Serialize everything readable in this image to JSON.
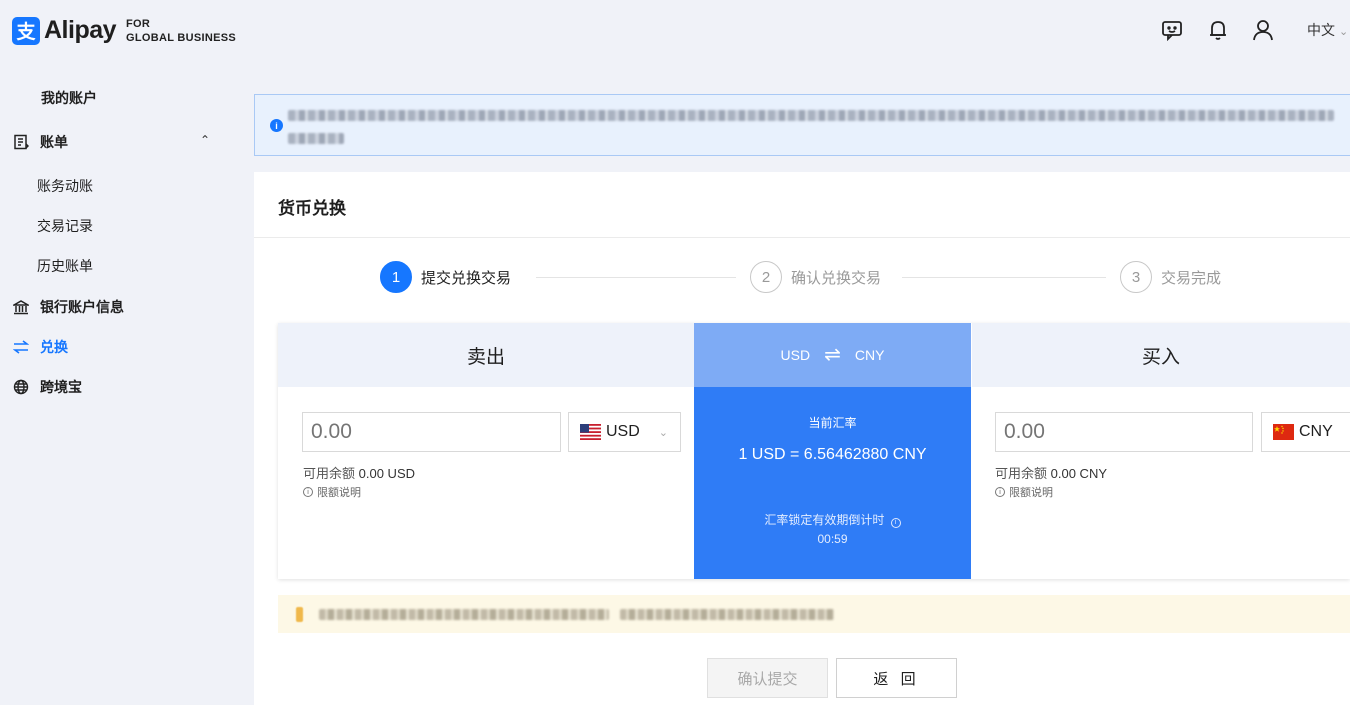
{
  "header": {
    "logo_text": "Alipay",
    "logo_sub_line1": "FOR",
    "logo_sub_line2": "GLOBAL BUSINESS",
    "language": "中文",
    "icons": [
      "feedback-icon",
      "bell-icon",
      "user-icon"
    ]
  },
  "sidebar": {
    "my_account": "我的账户",
    "bill": {
      "label": "账单",
      "icon": "bill-icon",
      "expanded": true
    },
    "bill_children": [
      "账务动账",
      "交易记录",
      "历史账单"
    ],
    "bank_info": {
      "label": "银行账户信息",
      "icon": "bank-icon"
    },
    "exchange": {
      "label": "兑换",
      "icon": "exchange-icon",
      "active": true
    },
    "cross_border": {
      "label": "跨境宝",
      "icon": "globe-icon"
    }
  },
  "card": {
    "title": "货币兑换"
  },
  "steps": [
    {
      "num": "1",
      "label": "提交兑换交易",
      "active": true
    },
    {
      "num": "2",
      "label": "确认兑换交易",
      "active": false
    },
    {
      "num": "3",
      "label": "交易完成",
      "active": false
    }
  ],
  "exchange": {
    "sell_title": "卖出",
    "buy_title": "买入",
    "pair_from": "USD",
    "pair_to": "CNY",
    "rate_label": "当前汇率",
    "rate_value": "1 USD = 6.56462880 CNY",
    "lock_label": "汇率锁定有效期倒计时",
    "countdown": "00:59",
    "sell": {
      "placeholder": "0.00",
      "currency": "USD",
      "balance_label": "可用余额",
      "balance_value": "0.00 USD",
      "limit_label": "限额说明"
    },
    "buy": {
      "placeholder": "0.00",
      "currency": "CNY",
      "balance_label": "可用余额",
      "balance_value": "0.00 CNY",
      "limit_label": "限额说明"
    }
  },
  "buttons": {
    "confirm": "确认提交",
    "back": "返 回"
  },
  "colors": {
    "primary": "#1677ff",
    "rate_panel": "#2f7cf6",
    "rate_header": "#7eabf5",
    "notice_bg": "#e8f1fd",
    "warning_bg": "#fdf8e6"
  }
}
